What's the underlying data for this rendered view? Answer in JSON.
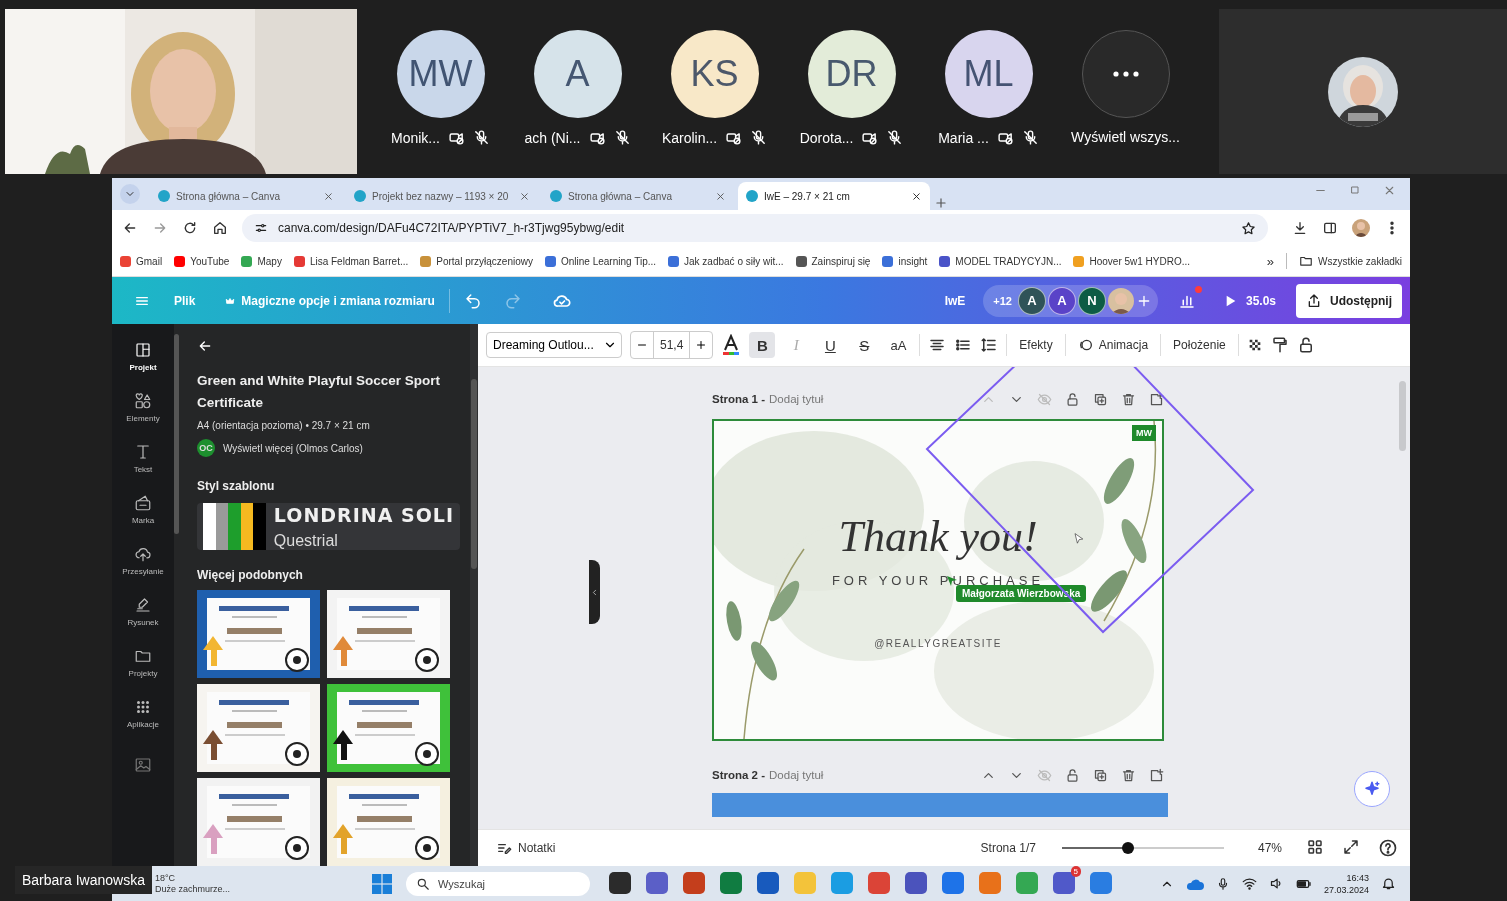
{
  "meeting": {
    "participants": [
      {
        "initials": "MW",
        "name": "Monik...",
        "color": "#c9d7ea"
      },
      {
        "initials": "A",
        "name": "ach (Ni...",
        "color": "#d6e3ea"
      },
      {
        "initials": "KS",
        "name": "Karolin...",
        "color": "#f8e8c8"
      },
      {
        "initials": "DR",
        "name": "Dorota...",
        "color": "#e3ecd9"
      },
      {
        "initials": "ML",
        "name": "Maria ...",
        "color": "#d8d5ee"
      }
    ],
    "more_label": "Wyświetl wszys...",
    "presenter_name": "Barbara Iwanowska"
  },
  "browser": {
    "tabs": [
      {
        "title": "Strona główna – Canva",
        "selected": false
      },
      {
        "title": "Projekt bez nazwy – 1193 × 20",
        "selected": false
      },
      {
        "title": "Strona główna – Canva",
        "selected": false
      },
      {
        "title": "IwE – 29.7 × 21 cm",
        "selected": true
      }
    ],
    "address": "canva.com/design/DAFu4C72ITA/PYPTiV7_h-r3Tjwg95ybwg/edit",
    "bookmarks": [
      {
        "label": "Gmail",
        "color": "#ea4335"
      },
      {
        "label": "YouTube",
        "color": "#ff0000"
      },
      {
        "label": "Mapy",
        "color": "#34a853"
      },
      {
        "label": "Lisa Feldman Barret...",
        "color": "#e53935"
      },
      {
        "label": "Portal przyłączeniowy",
        "color": "#c8913a"
      },
      {
        "label": "Online Learning Tip...",
        "color": "#3b6fd8"
      },
      {
        "label": "Jak zadbać o siły wit...",
        "color": "#3b6fd8"
      },
      {
        "label": "Zainspiruj się",
        "color": "#555555"
      },
      {
        "label": "insight",
        "color": "#3b6fd8"
      },
      {
        "label": "MODEL TRADYCYJN...",
        "color": "#4a53c8"
      },
      {
        "label": "Hoover 5w1 HYDRO...",
        "color": "#f0a020"
      }
    ],
    "overflow": "»",
    "all_bookmarks": "Wszystkie zakładki"
  },
  "header": {
    "file": "Plik",
    "magic": "Magiczne opcje i zmiana rozmiaru",
    "doc_name": "IwE",
    "extra_count": "+12",
    "collaborators": [
      {
        "initial": "A",
        "color": "#2f5358"
      },
      {
        "initial": "A",
        "color": "#5a43c8"
      },
      {
        "initial": "N",
        "color": "#0d5c45"
      }
    ],
    "timer": "35.0s",
    "share": "Udostępnij"
  },
  "toolbar": {
    "font": "Dreaming Outlou...",
    "size": "51,4",
    "styles": [
      {
        "glyph": "B",
        "kind": "bold",
        "selected": true,
        "disabled": false
      },
      {
        "glyph": "I",
        "kind": "italic",
        "selected": false,
        "disabled": true
      },
      {
        "glyph": "U",
        "kind": "underline",
        "selected": false,
        "disabled": false
      },
      {
        "glyph": "S",
        "kind": "strike",
        "selected": false,
        "disabled": false
      },
      {
        "glyph": "aA",
        "kind": "case",
        "selected": false,
        "disabled": false
      }
    ],
    "effects": "Efekty",
    "animation": "Animacja",
    "position": "Położenie"
  },
  "rail": [
    {
      "label": "Projekt",
      "kind": "layout",
      "selected": true
    },
    {
      "label": "Elementy",
      "kind": "elements",
      "selected": false
    },
    {
      "label": "Tekst",
      "kind": "text",
      "selected": false
    },
    {
      "label": "Marka",
      "kind": "brand",
      "selected": false
    },
    {
      "label": "Przesyłanie",
      "kind": "upload",
      "selected": false
    },
    {
      "label": "Rysunek",
      "kind": "draw",
      "selected": false
    },
    {
      "label": "Projekty",
      "kind": "folder",
      "selected": false
    },
    {
      "label": "Aplikacje",
      "kind": "apps",
      "selected": false
    }
  ],
  "panel": {
    "title": "Green and White Playful Soccer Sport Certificate",
    "meta": "A4 (orientacja pozioma) • 29.7 × 21 cm",
    "author_initials": "OC",
    "author_link": "Wyświetl więcej (Olmos Carlos)",
    "style_heading": "Styl szablonu",
    "palette": [
      {
        "color": "#ffffff"
      },
      {
        "color": "#9a9a9a"
      },
      {
        "color": "#1e9e2c"
      },
      {
        "color": "#f5b920"
      },
      {
        "color": "#000000"
      }
    ],
    "heading_font": "LONDRINA SOLI",
    "body_font": "Questrial",
    "similar_heading": "Więcej podobnych"
  },
  "canvas": {
    "pages": [
      {
        "label": "Strona 1 -",
        "title": "Dodaj tytuł",
        "up_disabled": true,
        "kind": "design"
      },
      {
        "label": "Strona 2 -",
        "title": "Dodaj tytuł",
        "up_disabled": false,
        "kind": "strip"
      }
    ],
    "design": {
      "heading": "Thank you!",
      "subheading": "FOR YOUR PURCHASE",
      "handle": "@REALLYGREATSITE",
      "editor_badge": "MW",
      "cursor_name": "Małgorzata Wierzbowska"
    },
    "notes": "Notatki",
    "page_indicator": "Strona 1/7",
    "zoom": {
      "level": 0.41
    },
    "zoom_label": "47%"
  },
  "taskbar": {
    "weather_temp": "18°C",
    "weather_text": "Duże zachmurze...",
    "search": {
      "placeholder": "Wyszukaj"
    },
    "apps": [
      {
        "color": "#2b2b2b"
      },
      {
        "color": "#5b5fc7"
      },
      {
        "color": "#c43e1c"
      },
      {
        "color": "#107c41"
      },
      {
        "color": "#185abd"
      },
      {
        "color": "#f3c33a"
      },
      {
        "color": "#1b9de2"
      },
      {
        "color": "#db4437"
      },
      {
        "color": "#4b53bc"
      },
      {
        "color": "#1e73e8"
      },
      {
        "color": "#e8711a"
      },
      {
        "color": "#34a853"
      },
      {
        "color": "#5059c9",
        "badge": "5"
      },
      {
        "color": "#2a7de1"
      }
    ],
    "time": "16:43",
    "date": "27.03.2024"
  }
}
